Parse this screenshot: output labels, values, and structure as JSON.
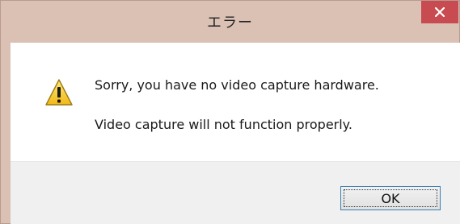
{
  "window": {
    "title": "エラー",
    "close_icon": "close-icon",
    "colors": {
      "frame": "#dbc1b4",
      "close_button": "#c74b50",
      "content_bg": "#ffffff",
      "footer_bg": "#f0f0f0"
    }
  },
  "message": {
    "icon": "warning-icon",
    "line1": "Sorry, you have no video capture hardware.",
    "line2": "Video capture will not function properly."
  },
  "buttons": {
    "ok_label": "OK"
  }
}
